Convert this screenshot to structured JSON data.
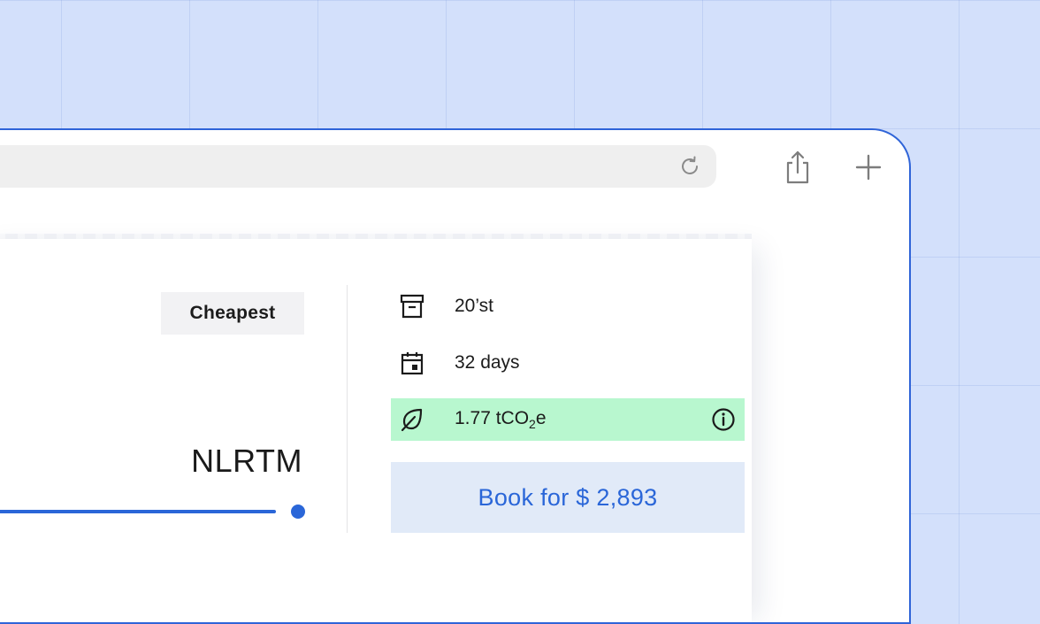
{
  "browser": {
    "reload_icon": "reload-icon",
    "share_icon": "share-icon",
    "new_tab_icon": "plus-icon"
  },
  "quote": {
    "badge": "Cheapest",
    "destination": "NLRTM",
    "container": {
      "icon": "archive-box-icon",
      "label": "20’st"
    },
    "transit": {
      "icon": "calendar-icon",
      "label": "32 days"
    },
    "emissions": {
      "icon": "leaf-icon",
      "value": "1.77 tCO",
      "subscript": "2",
      "suffix": "e",
      "info_icon": "info-icon",
      "highlight_color": "#b8f7cf"
    },
    "book_label": "Book for $ 2,893",
    "accent_color": "#2a66d8"
  }
}
